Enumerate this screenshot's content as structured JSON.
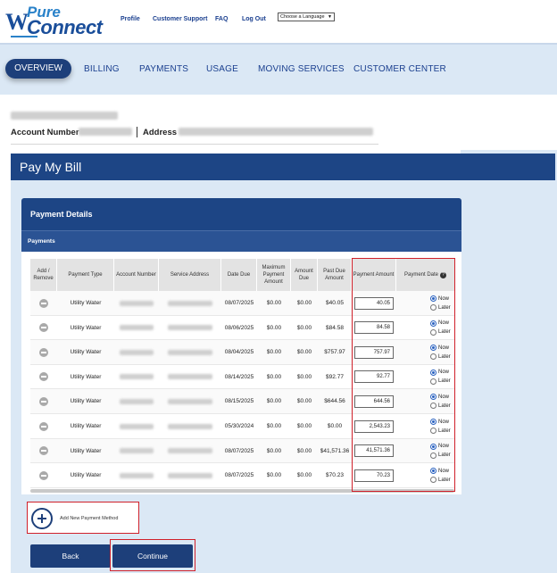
{
  "logo": {
    "pure": "Pure",
    "connect": "Connect",
    "w": "W"
  },
  "top_links": [
    "Profile",
    "Customer Support",
    "FAQ",
    "Log Out"
  ],
  "language_select": "Choose a Language",
  "nav": {
    "active": "OVERVIEW",
    "items": [
      "BILLING",
      "PAYMENTS",
      "USAGE",
      "MOVING SERVICES",
      "CUSTOMER CENTER"
    ]
  },
  "account": {
    "number_label": "Account Number",
    "address_label": "Address"
  },
  "page_title": "Pay My Bill",
  "payment_details_title": "Payment Details",
  "payments_title": "Payments",
  "table": {
    "headers": [
      "Add / Remove",
      "Payment Type",
      "Account Number",
      "Service Address",
      "Date Due",
      "Maximum Payment Amount",
      "Amount Due",
      "Past Due Amount",
      "Payment Amount",
      "Payment Date"
    ],
    "rows": [
      {
        "type": "Utility Water",
        "date_due": "08/07/2025",
        "max": "$0.00",
        "due": "$0.00",
        "past_due": "$40.05",
        "amount": "40.05"
      },
      {
        "type": "Utility Water",
        "date_due": "08/06/2025",
        "max": "$0.00",
        "due": "$0.00",
        "past_due": "$84.58",
        "amount": "84.58"
      },
      {
        "type": "Utility Water",
        "date_due": "08/04/2025",
        "max": "$0.00",
        "due": "$0.00",
        "past_due": "$757.97",
        "amount": "757.97"
      },
      {
        "type": "Utility Water",
        "date_due": "08/14/2025",
        "max": "$0.00",
        "due": "$0.00",
        "past_due": "$92.77",
        "amount": "92.77"
      },
      {
        "type": "Utility Water",
        "date_due": "08/15/2025",
        "max": "$0.00",
        "due": "$0.00",
        "past_due": "$644.56",
        "amount": "644.56"
      },
      {
        "type": "Utility Water",
        "date_due": "05/30/2024",
        "max": "$0.00",
        "due": "$0.00",
        "past_due": "$0.00",
        "amount": "2,543.23"
      },
      {
        "type": "Utility Water",
        "date_due": "08/07/2025",
        "max": "$0.00",
        "due": "$0.00",
        "past_due": "$41,571.36",
        "amount": "41,571.36"
      },
      {
        "type": "Utility Water",
        "date_due": "08/07/2025",
        "max": "$0.00",
        "due": "$0.00",
        "past_due": "$70.23",
        "amount": "70.23"
      }
    ],
    "radio_now": "Now",
    "radio_later": "Later",
    "help_glyph": "?"
  },
  "add_payment_method": "Add New Payment Method",
  "buttons": {
    "back": "Back",
    "continue": "Continue"
  },
  "colors": {
    "navy": "#1d4585",
    "highlight": "#d0202a",
    "nav_bg": "#dbe8f5"
  }
}
